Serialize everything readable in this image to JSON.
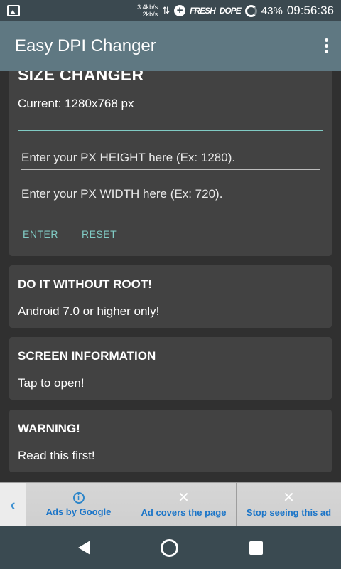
{
  "status_bar": {
    "net_up": "3.4kb/s",
    "net_down": "2kb/s",
    "graffiti_1": "FRESH",
    "graffiti_2": "DOPE",
    "battery": "43%",
    "time": "09:56:36"
  },
  "app_bar": {
    "title": "Easy DPI Changer"
  },
  "size_changer": {
    "title": "SIZE CHANGER",
    "current": "Current: 1280x768 px",
    "height_placeholder": "Enter your PX HEIGHT here (Ex: 1280).",
    "width_placeholder": "Enter your PX WIDTH here (Ex: 720).",
    "enter_label": "ENTER",
    "reset_label": "RESET"
  },
  "cards": {
    "no_root": {
      "title": "DO IT WITHOUT ROOT!",
      "subtitle": "Android 7.0 or higher only!"
    },
    "screen_info": {
      "title": "SCREEN INFORMATION",
      "subtitle": "Tap to open!"
    },
    "warning": {
      "title": "WARNING!",
      "subtitle": "Read this first!"
    }
  },
  "ad_bar": {
    "ads_by_google": "Ads by Google",
    "ad_covers": "Ad covers the page",
    "stop_seeing": "Stop seeing this ad"
  },
  "colors": {
    "accent": "#80cbc4",
    "app_bar": "#5f7882",
    "ad_link": "#1b75c8"
  },
  "icons": {
    "status_image": "image-icon",
    "data_arrows": "data-arrows-icon",
    "data_saver": "plus-circle-icon",
    "battery": "battery-ring-icon",
    "overflow": "more-vert-icon",
    "ad_back": "chevron-left-icon",
    "ad_info": "info-icon",
    "ad_close": "close-icon",
    "nav_back": "back-triangle-icon",
    "nav_home": "home-circle-icon",
    "nav_recent": "recent-square-icon"
  }
}
